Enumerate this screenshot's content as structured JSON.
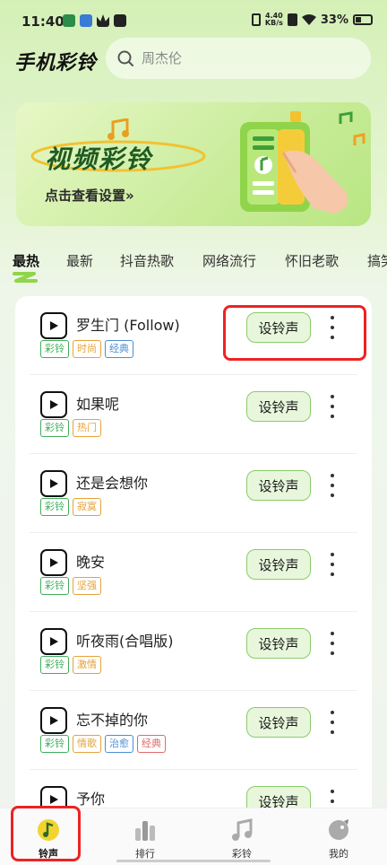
{
  "status_bar": {
    "time": "11:40",
    "speed_value": "4.40",
    "speed_unit": "KB/s",
    "battery": "33%"
  },
  "header": {
    "app_title": "手机彩铃",
    "search_placeholder": "周杰伦"
  },
  "banner": {
    "title": "视频彩铃",
    "subtitle": "点击查看设置»"
  },
  "tabs": [
    {
      "label": "最热",
      "active": true
    },
    {
      "label": "最新"
    },
    {
      "label": "抖音热歌"
    },
    {
      "label": "网络流行"
    },
    {
      "label": "怀旧老歌"
    },
    {
      "label": "搞笑"
    }
  ],
  "set_button_label": "设铃声",
  "songs": [
    {
      "title": "罗生门 (Follow)",
      "tags": [
        "彩铃",
        "时尚",
        "经典"
      ]
    },
    {
      "title": "如果呢",
      "tags": [
        "彩铃",
        "热门"
      ]
    },
    {
      "title": "还是会想你",
      "tags": [
        "彩铃",
        "寂寞"
      ]
    },
    {
      "title": "晚安",
      "tags": [
        "彩铃",
        "坚强"
      ]
    },
    {
      "title": "听夜雨(合唱版)",
      "tags": [
        "彩铃",
        "激情"
      ]
    },
    {
      "title": "忘不掉的你",
      "tags": [
        "彩铃",
        "情歌",
        "治愈",
        "经典"
      ]
    },
    {
      "title": "予你",
      "tags": []
    }
  ],
  "tag_colors": {
    "彩铃": "#3fae5a",
    "时尚": "#e5a33b",
    "经典": "#4a8fd6",
    "热门": "#e5a33b",
    "寂寞": "#e5a33b",
    "坚强": "#e5a33b",
    "激情": "#e5a33b",
    "情歌": "#e5a33b",
    "治愈": "#4a8fd6",
    "经典_alt": "#e06a6a"
  },
  "bottom_nav": [
    {
      "label": "铃声",
      "icon": "music-note-icon",
      "active": true
    },
    {
      "label": "排行",
      "icon": "ranking-icon"
    },
    {
      "label": "彩铃",
      "icon": "ringback-icon"
    },
    {
      "label": "我的",
      "icon": "profile-icon"
    }
  ]
}
